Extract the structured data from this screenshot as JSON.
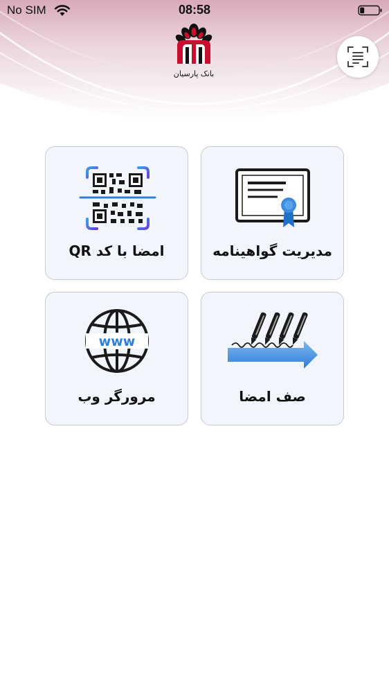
{
  "status_bar": {
    "carrier": "No SIM",
    "time": "08:58"
  },
  "header": {
    "logo_icon": "bank-parsian-logo",
    "logo_text": "بانک پارسیان",
    "brand_color": "#c8102e",
    "scan_icon": "document-scan-icon"
  },
  "tiles": [
    {
      "label": "مدیریت گواهینامه",
      "icon": "certificate-icon"
    },
    {
      "label": "امضا با کد QR",
      "icon": "qr-code-icon"
    },
    {
      "label": "صف امضا",
      "icon": "signing-queue-icon"
    },
    {
      "label": "مرورگر وب",
      "icon": "web-globe-icon"
    }
  ],
  "web_icon_text": "www",
  "colors": {
    "tile_background": "#f2f5fb",
    "tile_border": "#c7cbd2",
    "accent_blue": "#2f7fd8",
    "header_pink": "#dcb3c0"
  }
}
